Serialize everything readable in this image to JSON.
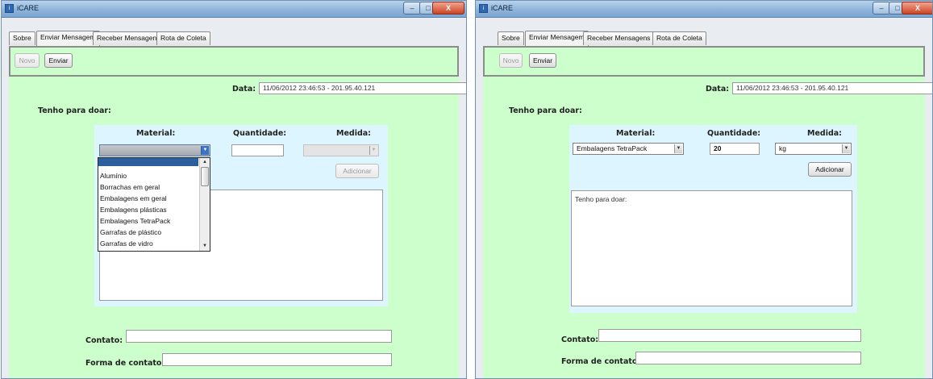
{
  "app_title": "iCARE",
  "window_controls": {
    "minimize": "–",
    "maximize": "□",
    "close": "X"
  },
  "tabs": [
    {
      "label": "Sobre"
    },
    {
      "label": "Enviar Mensagem"
    },
    {
      "label": "Receber Mensagens"
    },
    {
      "label": "Rota de Coleta"
    }
  ],
  "toolbar": {
    "new_label": "Novo",
    "send_label": "Enviar"
  },
  "form": {
    "date_label": "Data:",
    "date_value": "11/06/2012 23:46:53 - 201.95.40.121",
    "section_title": "Tenho para doar:",
    "material_label": "Material:",
    "quantity_label": "Quantidade:",
    "measure_label": "Medida:",
    "add_button": "Adicionar",
    "contact_label": "Contato:",
    "contact_form_label": "Forma de contato:"
  },
  "left": {
    "material_options": [
      "Alumínio",
      "Borrachas em geral",
      "Embalagens em geral",
      "Embalagens plásticas",
      "Embalagens TetraPack",
      "Garrafas de plástico",
      "Garrafas de vidro"
    ]
  },
  "right": {
    "material_value": "Embalagens TetraPack",
    "quantity_value": "20",
    "measure_value": "kg",
    "textarea_text": "Tenho para doar:"
  }
}
